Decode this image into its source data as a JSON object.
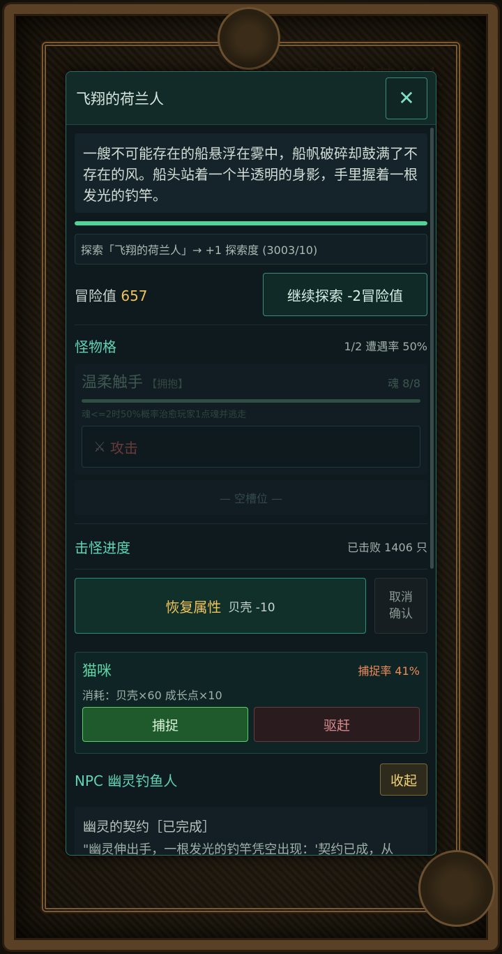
{
  "background": {
    "title": "飞翔的荷兰人"
  },
  "modal": {
    "title": "飞翔的荷兰人",
    "close_icon": "close-icon",
    "description": "一艘不可能存在的船悬浮在雾中，船帆破碎却鼓满了不存在的风。船头站着一个半透明的身影，手里握着一根发光的钓竿。",
    "progress": 1.0,
    "explore_log": "探索「飞翔的荷兰人」→ +1 探索度 (3003/10)",
    "adventure": {
      "label": "冒险值",
      "value": "657",
      "continue_button": "继续探索 -2冒险值"
    },
    "monster_section": {
      "title": "怪物格",
      "meta": "1/2 遭遇率 50%",
      "monster": {
        "name": "温柔触手",
        "tag": "【拥抱】",
        "hp": "魂 8/8",
        "hp_fraction": 1.0,
        "note": "魂<=2时50%概率治愈玩家1点魂并逃走",
        "attack_label": "攻击",
        "attack_icon": "crossed-swords-icon"
      },
      "empty_slot": "— 空槽位 —"
    },
    "kill_section": {
      "title": "击怪进度",
      "meta": "已击败 1406 只"
    },
    "restore": {
      "label": "恢复属性",
      "cost": "贝壳 -10",
      "cancel_line1": "取消",
      "cancel_line2": "确认"
    },
    "capture": {
      "name": "猫咪",
      "rate": "捕捉率 41%",
      "cost": "消耗：贝壳×60  成长点×10",
      "catch_button": "捕捉",
      "drive_button": "驱赶"
    },
    "npc": {
      "title": "NPC 幽灵钓鱼人",
      "collapse_button": "收起",
      "quest": "幽灵的契约［已完成］",
      "text": "\"幽灵伸出手，一根发光的钓竿凭空出现：'契约已成，从"
    }
  }
}
